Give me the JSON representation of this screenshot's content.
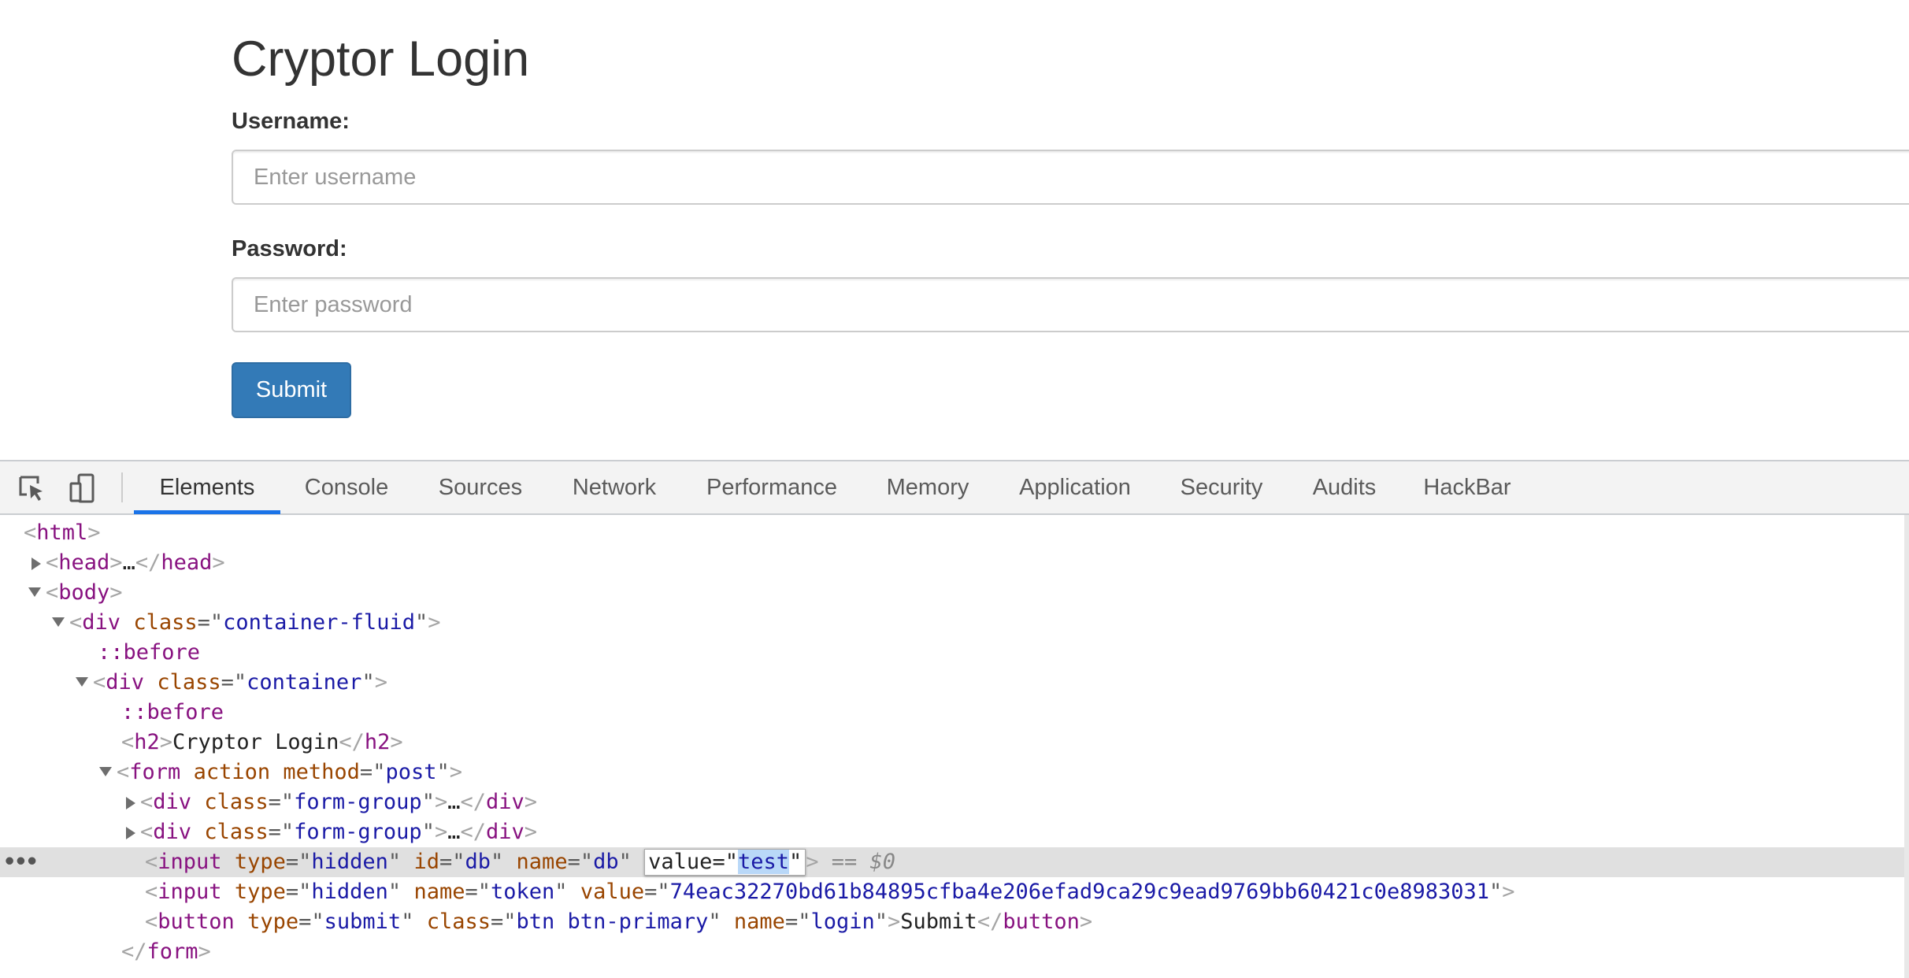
{
  "page": {
    "title": "Cryptor Login",
    "username_label": "Username:",
    "username_placeholder": "Enter username",
    "password_label": "Password:",
    "password_placeholder": "Enter password",
    "submit_label": "Submit"
  },
  "devtools": {
    "icons": [
      "inspect-element-icon",
      "device-toolbar-icon"
    ],
    "tabs": [
      "Elements",
      "Console",
      "Sources",
      "Network",
      "Performance",
      "Memory",
      "Application",
      "Security",
      "Audits",
      "HackBar"
    ],
    "active_tab": "Elements",
    "accent_color": "#1a73e8"
  },
  "dom": {
    "html_open": "html",
    "head": "head",
    "body": "body",
    "div": "div",
    "class_attr": "class",
    "container_fluid": "container-fluid",
    "before": "::before",
    "container": "container",
    "h2": "h2",
    "h2_text": "Cryptor Login",
    "form": "form",
    "action_attr": "action",
    "method_attr": "method",
    "post": "post",
    "form_group": "form-group",
    "ellipsis": "…",
    "input": "input",
    "type_attr": "type",
    "hidden": "hidden",
    "id_attr": "id",
    "name_attr": "name",
    "db": "db",
    "value_attr": "value",
    "db_value": "test",
    "selected_marker": "== $0",
    "token": "token",
    "token_value": "74eac32270bd61b84895cfba4e206efad9ca29c9ead9769bb60421c0e8983031",
    "button": "button",
    "submit": "submit",
    "btn_class": "btn btn-primary",
    "login": "login",
    "button_text": "Submit",
    "dots": "•••"
  }
}
